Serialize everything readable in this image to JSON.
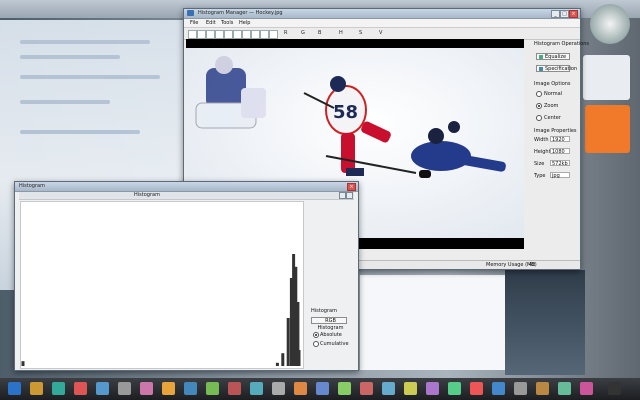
{
  "main_window": {
    "title": "Histogram Manager — Hockey.jpg",
    "menu": [
      "File",
      "Edit",
      "Tools",
      "Help"
    ],
    "toolbar_labels": [
      "R",
      "G",
      "B",
      "H",
      "S",
      "V"
    ],
    "right_panel": {
      "section1": "Histogram Operations",
      "equalize_button": "Equalize",
      "specification_button": "Specification",
      "section2": "Image Options",
      "options": [
        "Normal",
        "Zoom",
        "Center"
      ],
      "selected_option": "Zoom",
      "section3": "Image Properties",
      "props": [
        {
          "label": "Width",
          "value": "1920"
        },
        {
          "label": "Height",
          "value": "1080"
        },
        {
          "label": "Size",
          "value": "572kb"
        },
        {
          "label": "Type",
          "value": "jpg"
        }
      ]
    },
    "status": {
      "memory_label": "Memory Usage (MB)",
      "memory_value": "42"
    }
  },
  "hist_window": {
    "title": "Histogram",
    "panel_title": "Histogram",
    "group_label": "Histogram",
    "rgb_button": "RGB Histogram",
    "modes": [
      "Absolute",
      "Cumulative"
    ],
    "selected_mode": "Absolute"
  },
  "player_numbers": [
    "58"
  ],
  "chart_data": {
    "type": "bar",
    "title": "",
    "x": [
      0,
      235,
      240,
      245,
      248,
      250,
      252,
      254,
      255
    ],
    "values": [
      3,
      2,
      8,
      30,
      55,
      70,
      62,
      40,
      10
    ],
    "xlim": [
      0,
      255
    ],
    "ylim": [
      0,
      100
    ],
    "grid": false
  }
}
